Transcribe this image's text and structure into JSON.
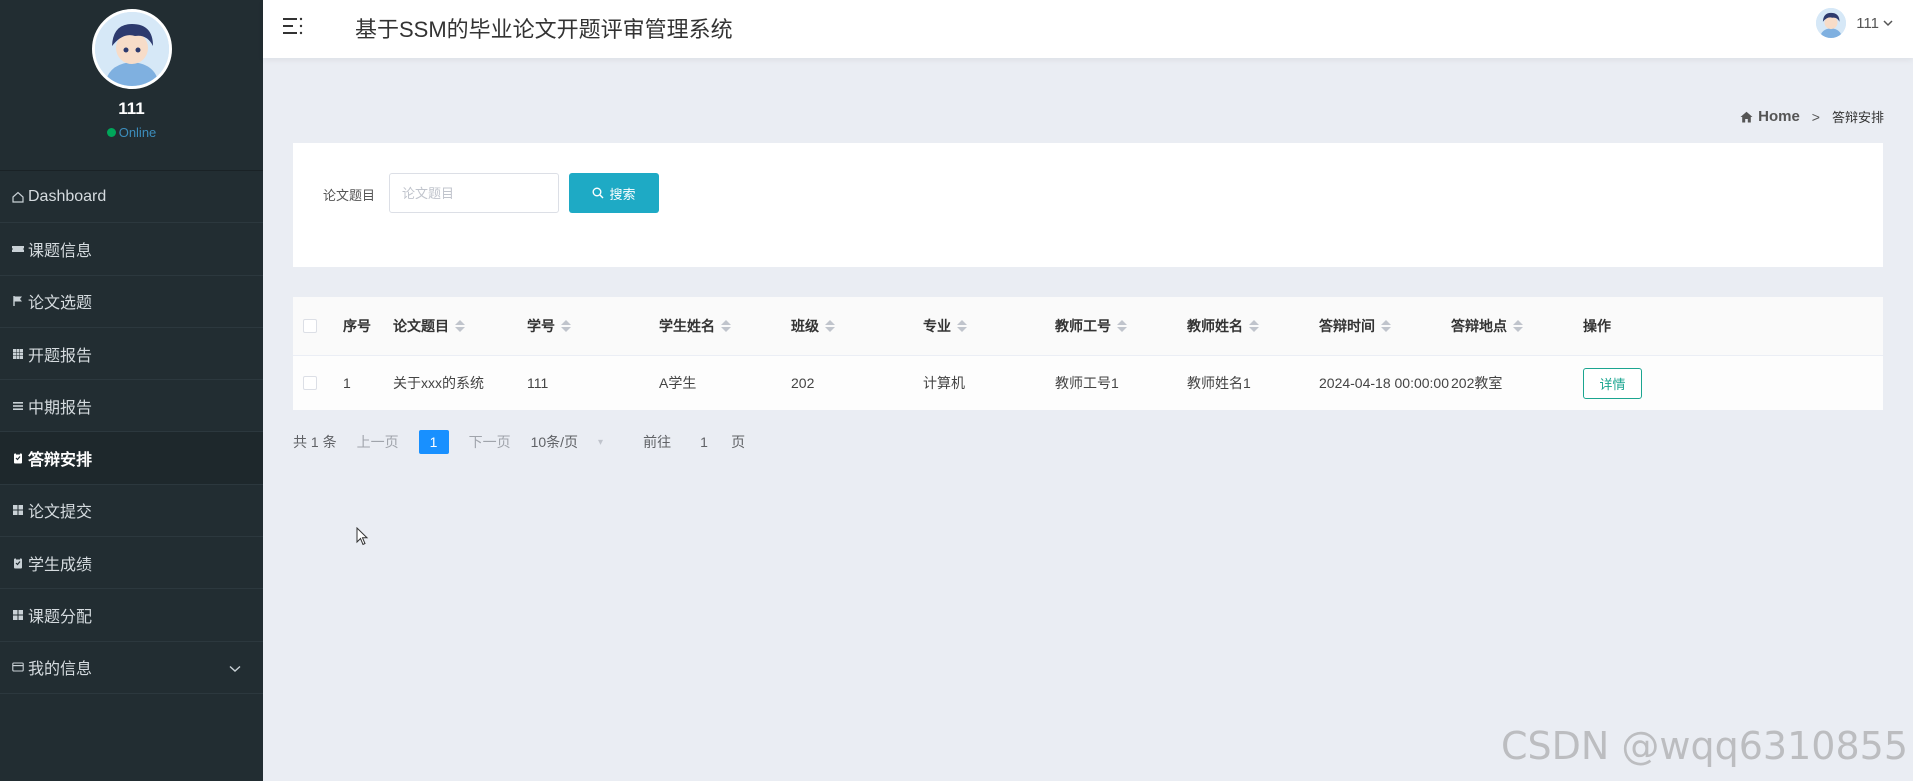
{
  "app": {
    "title": "基于SSM的毕业论文开题评审管理系统"
  },
  "user": {
    "name": "111",
    "status": "Online"
  },
  "sidebar": {
    "items": [
      {
        "label": "Dashboard",
        "icon": "home-icon"
      },
      {
        "label": "课题信息",
        "icon": "ticket-icon"
      },
      {
        "label": "论文选题",
        "icon": "flag-icon"
      },
      {
        "label": "开题报告",
        "icon": "grid-icon"
      },
      {
        "label": "中期报告",
        "icon": "list-icon"
      },
      {
        "label": "答辩安排",
        "icon": "clipboard-icon",
        "active": true
      },
      {
        "label": "论文提交",
        "icon": "apps-icon"
      },
      {
        "label": "学生成绩",
        "icon": "clipboard-icon"
      },
      {
        "label": "课题分配",
        "icon": "apps-icon"
      },
      {
        "label": "我的信息",
        "icon": "card-icon"
      }
    ]
  },
  "breadcrumb": {
    "home": "Home",
    "separator": ">",
    "current": "答辩安排"
  },
  "search": {
    "label": "论文题目",
    "placeholder": "论文题目",
    "value": "",
    "button": "搜索"
  },
  "table": {
    "headers": [
      "序号",
      "论文题目",
      "学号",
      "学生姓名",
      "班级",
      "专业",
      "教师工号",
      "教师姓名",
      "答辩时间",
      "答辩地点",
      "操作"
    ],
    "rows": [
      {
        "index": "1",
        "title": "关于xxx的系统",
        "student_id": "111",
        "student_name": "A学生",
        "class": "202",
        "major": "计算机",
        "teacher_id": "教师工号1",
        "teacher_name": "教师姓名1",
        "time": "2024-04-18 00:00:00",
        "location": "202教室",
        "action": "详情"
      }
    ]
  },
  "pagination": {
    "total": "共 1 条",
    "prev": "上一页",
    "current_page": "1",
    "next": "下一页",
    "page_size": "10条/页",
    "goto_prefix": "前往",
    "goto_value": "1",
    "goto_suffix": "页"
  },
  "watermark": "CSDN @wqq6310855",
  "colors": {
    "sidebar_bg": "#222d32",
    "accent": "#1eaac5",
    "page_active": "#1890ff",
    "detail": "#1ba590"
  }
}
